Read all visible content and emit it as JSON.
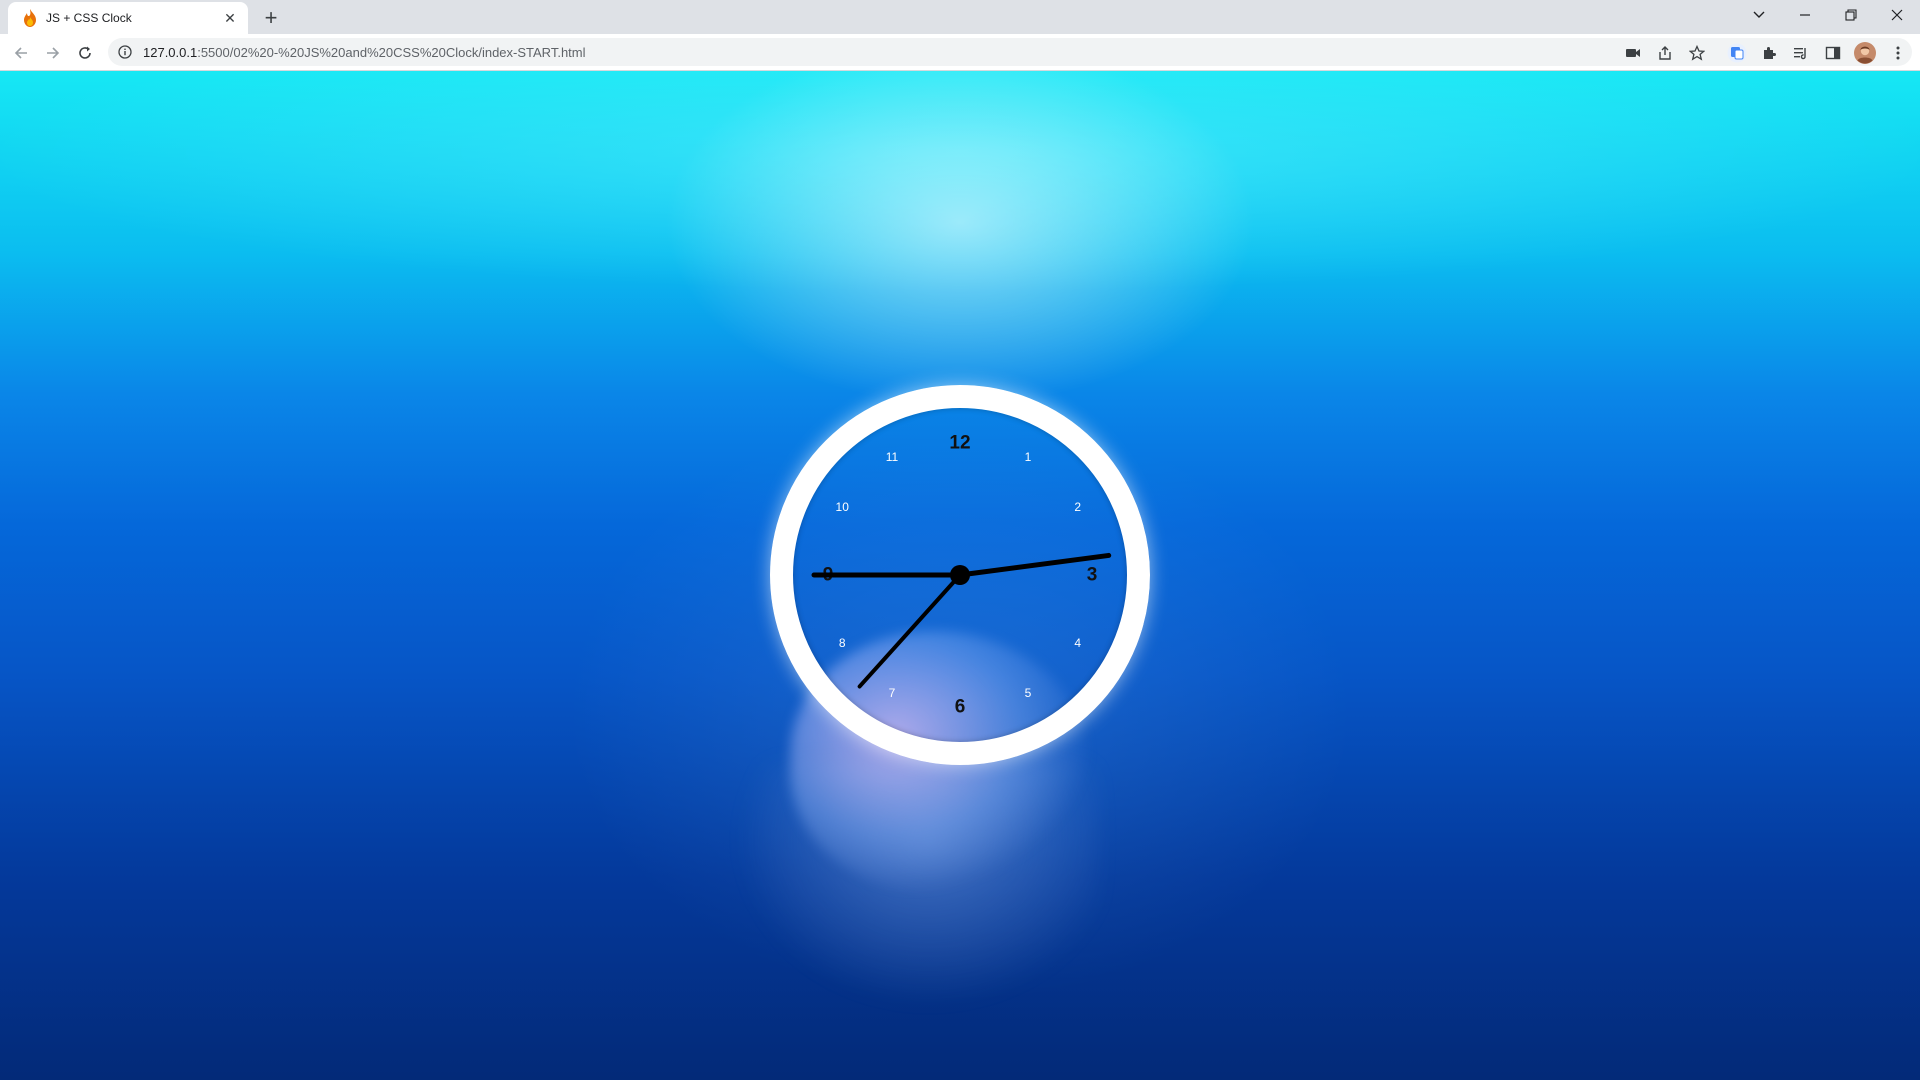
{
  "browser": {
    "tab_title": "JS + CSS Clock",
    "new_tab_label": "+",
    "close_label": "✕",
    "url_host": "127.0.0.1",
    "url_path": ":5500/02%20-%20JS%20and%20CSS%20Clock/index-START.html"
  },
  "clock": {
    "numerals_major": [
      "12",
      "3",
      "6",
      "9"
    ],
    "numerals_minor": [
      "1",
      "2",
      "4",
      "5",
      "7",
      "8",
      "10",
      "11"
    ],
    "time": {
      "hour": 2,
      "minute": 45,
      "second": 37
    },
    "colors": {
      "hands": "#000000",
      "rim": "#ffffff",
      "minor_numerals": "#ffffff",
      "major_numerals": "#111111"
    }
  }
}
